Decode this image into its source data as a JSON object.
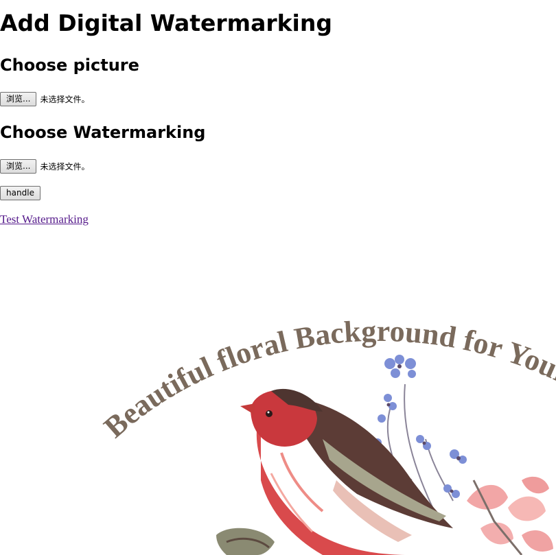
{
  "header": {
    "title": "Add Digital Watermarking"
  },
  "picture_section": {
    "heading": "Choose picture",
    "browse_label": "浏览...",
    "status": "未选择文件。"
  },
  "watermark_section": {
    "heading": "Choose Watermarking",
    "browse_label": "浏览...",
    "status": "未选择文件。"
  },
  "handle_button": {
    "label": "handle"
  },
  "test_link": {
    "label": "Test Watermarking"
  },
  "image": {
    "arc_text": "Beautiful floral Background for Your D",
    "text_color": "#7a6a5c"
  },
  "colors": {
    "link_visited": "#551a8b"
  }
}
